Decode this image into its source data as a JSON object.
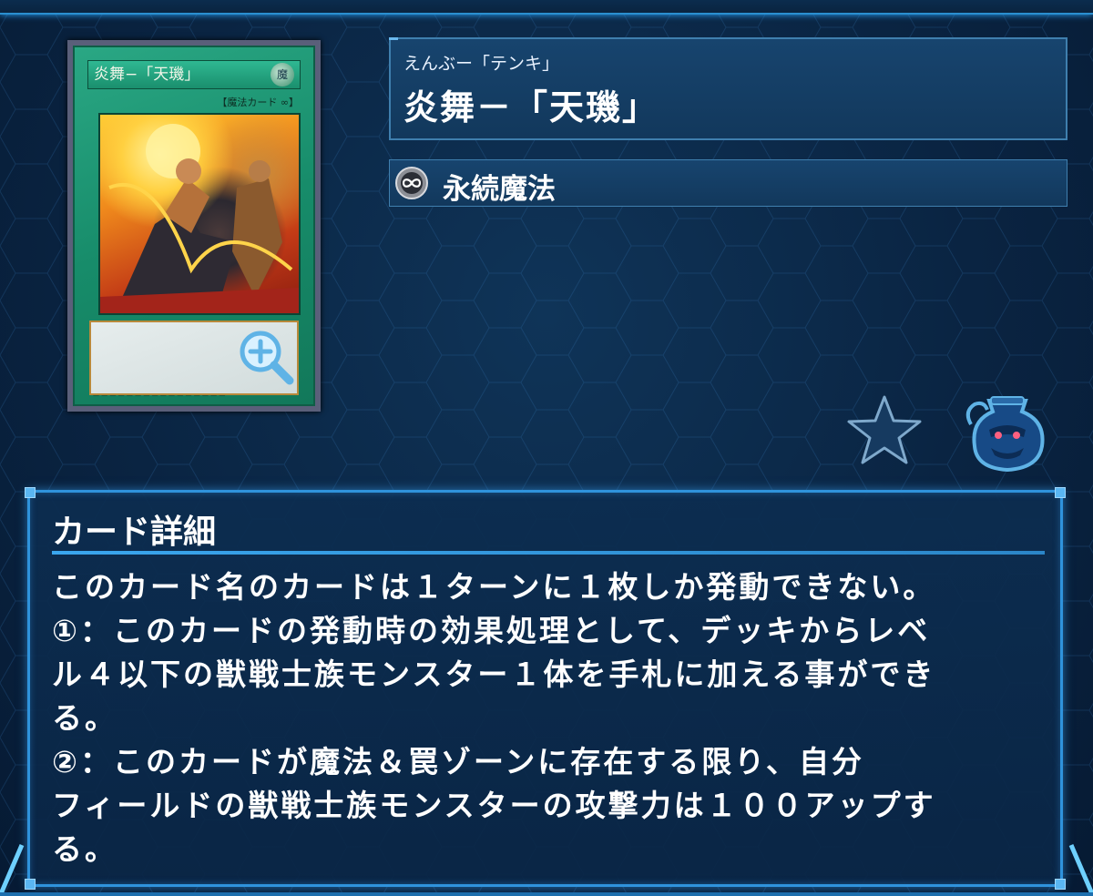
{
  "card": {
    "ruby": "えんぶー「テンキ」",
    "name": "炎舞－「天璣」",
    "type": "永続魔法",
    "type_icon": "continuous-infinity-icon",
    "thumbnail": {
      "name_text": "炎舞−「天璣」",
      "attribute_text": "魔",
      "type_line": "【魔法カード ∞】"
    }
  },
  "actions": {
    "zoom_icon": "magnify-plus-icon",
    "favorite_icon": "star-icon",
    "pot_icon": "pot-of-greed-icon"
  },
  "details": {
    "title": "カード詳細",
    "lines": [
      "このカード名のカードは１ターンに１枚しか発動できない。",
      "①：このカードの発動時の効果処理として、デッキからレベ",
      "ル４以下の獣戦士族モンスター１体を手札に加える事ができ",
      "る。",
      "②：このカードが魔法＆罠ゾーンに存在する限り、自分",
      "フィールドの獣戦士族モンスターの攻撃力は１００アップす",
      "る。"
    ]
  },
  "colors": {
    "accent": "#2f93dc",
    "panel": "#17446e",
    "card_green": "#1a9673"
  }
}
